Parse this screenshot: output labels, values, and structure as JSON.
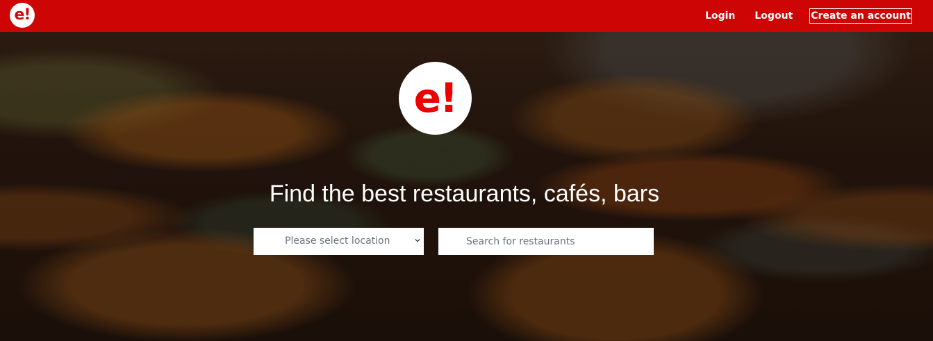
{
  "header": {
    "logo_text": "e!",
    "nav": {
      "login": "Login",
      "logout": "Logout",
      "create_account": "Create an account"
    }
  },
  "hero": {
    "logo_text": "e!",
    "title": "Find the best restaurants, cafés, bars",
    "location_select": {
      "selected": "Please select location"
    },
    "search": {
      "placeholder": "Search for restaurants"
    }
  },
  "colors": {
    "brand_red": "#ce0505",
    "logo_red": "#ee0000"
  }
}
